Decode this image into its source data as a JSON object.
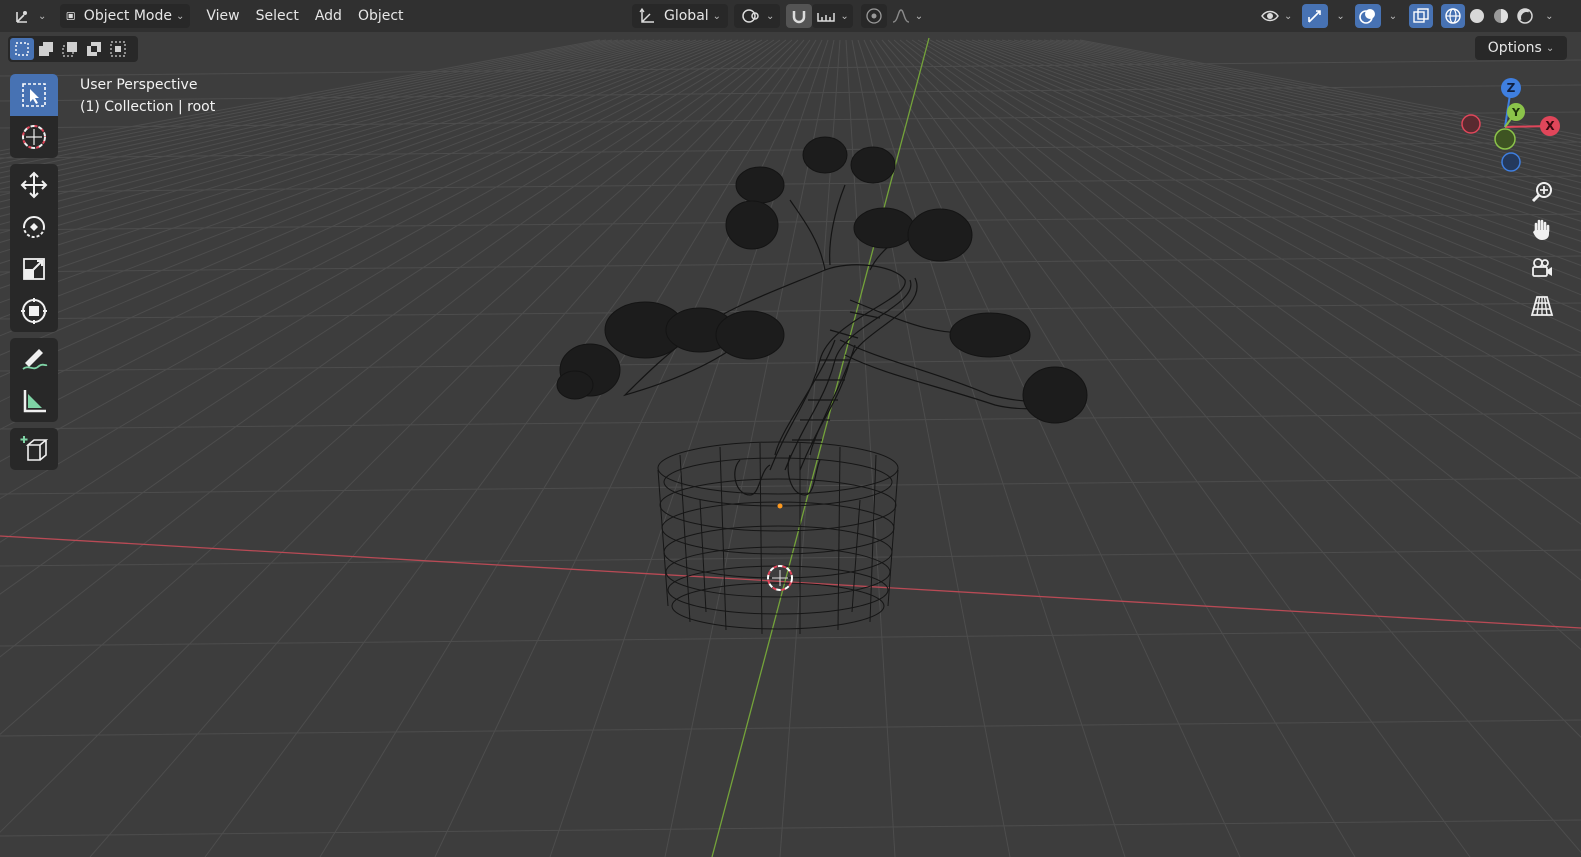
{
  "header": {
    "mode_label": "Object Mode",
    "menus": [
      "View",
      "Select",
      "Add",
      "Object"
    ],
    "orientation_label": "Global"
  },
  "toolbar": {
    "options_label": "Options"
  },
  "viewport": {
    "view_name": "User Perspective",
    "collection_info": "(1) Collection | root"
  },
  "gizmo": {
    "z_label": "Z",
    "y_label": "Y",
    "x_label": "X"
  },
  "colors": {
    "accent": "#4772b3",
    "header_bg": "#303030",
    "viewport_bg": "#3d3d3d",
    "x_axis": "#e0465a",
    "y_axis": "#8bc34a",
    "z_axis": "#3f7fe0"
  },
  "icons": {
    "editor_type": "axis-editor-icon",
    "mode": "object-mode-icon",
    "orientation": "transform-orientation-icon",
    "pivot": "pivot-icon",
    "snap": "snap-magnet-icon",
    "snap_target": "snap-increment-icon",
    "proportional": "proportional-edit-icon",
    "falloff": "falloff-curve-icon",
    "visibility": "eye-icon",
    "gizmos": "gizmo-icon",
    "overlays": "overlay-icon",
    "xray": "xray-icon",
    "shading_wireframe": "wireframe-shading-icon",
    "shading_solid": "solid-shading-icon",
    "shading_material": "material-shading-icon",
    "shading_rendered": "rendered-shading-icon"
  }
}
